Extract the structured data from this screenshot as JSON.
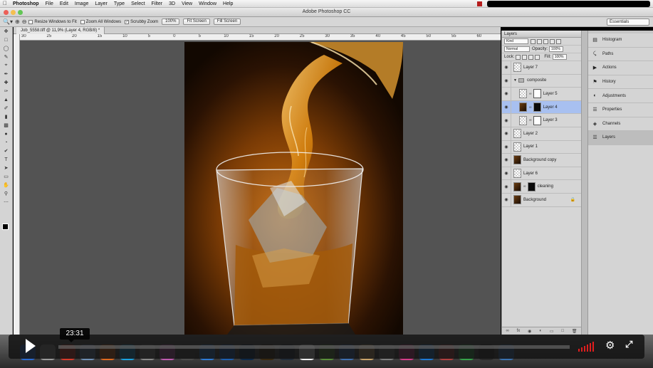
{
  "menubar": {
    "app_name": "Photoshop",
    "items": [
      "File",
      "Edit",
      "Image",
      "Layer",
      "Type",
      "Select",
      "Filter",
      "3D",
      "View",
      "Window",
      "Help"
    ]
  },
  "window": {
    "title": "Adobe Photoshop CC"
  },
  "options_bar": {
    "checkboxes": [
      {
        "label": "Resize Windows to Fit",
        "checked": false
      },
      {
        "label": "Zoom All Windows",
        "checked": false
      },
      {
        "label": "Scrubby Zoom",
        "checked": true
      }
    ],
    "buttons": [
      "100%",
      "Fit Screen",
      "Fill Screen"
    ],
    "workspace": "Essentials"
  },
  "document": {
    "tab_title": "Job_5558.tiff @ 11,9% (Layer 4, RGB/8) *",
    "ruler_ticks": [
      "30",
      "25",
      "20",
      "15",
      "10",
      "5",
      "0",
      "5",
      "10",
      "15",
      "20",
      "25",
      "30",
      "35",
      "40",
      "45",
      "50",
      "55",
      "60"
    ]
  },
  "layers_panel": {
    "tab_label": "Layers",
    "kind_filter": "Kind",
    "blend_mode": "Normal",
    "opacity_label": "Opacity:",
    "opacity_value": "100%",
    "lock_label": "Lock:",
    "fill_label": "Fill:",
    "fill_value": "100%",
    "layers": [
      {
        "name": "Layer 7",
        "thumb": "transparent",
        "selected": false,
        "indent": false
      },
      {
        "name": "composite",
        "thumb": "group",
        "selected": false,
        "indent": false
      },
      {
        "name": "Layer 5",
        "thumb": "transparent",
        "mask": true,
        "selected": false,
        "indent": true
      },
      {
        "name": "Layer 4",
        "thumb": "photo",
        "mask": true,
        "selected": true,
        "indent": true
      },
      {
        "name": "Layer 3",
        "thumb": "transparent",
        "mask": true,
        "selected": false,
        "indent": true
      },
      {
        "name": "Layer 2",
        "thumb": "transparent",
        "selected": false,
        "indent": false
      },
      {
        "name": "Layer 1",
        "thumb": "transparent",
        "selected": false,
        "indent": false
      },
      {
        "name": "Background copy",
        "thumb": "photo",
        "selected": false,
        "indent": false
      },
      {
        "name": "Layer 6",
        "thumb": "transparent",
        "selected": false,
        "indent": false
      },
      {
        "name": "cleaning",
        "thumb": "photo",
        "mask": true,
        "selected": false,
        "indent": false
      },
      {
        "name": "Background",
        "thumb": "photo",
        "locked": true,
        "selected": false,
        "indent": false
      }
    ]
  },
  "dock_panels": [
    {
      "label": "Histogram",
      "icon": "histogram-icon",
      "active": false
    },
    {
      "label": "Paths",
      "icon": "paths-icon",
      "active": false
    },
    {
      "label": "Actions",
      "icon": "actions-icon",
      "active": false
    },
    {
      "label": "History",
      "icon": "history-icon",
      "active": false
    },
    {
      "label": "Adjustments",
      "icon": "adjustments-icon",
      "active": false
    },
    {
      "label": "Properties",
      "icon": "properties-icon",
      "active": false
    },
    {
      "label": "Channels",
      "icon": "channels-icon",
      "active": false
    },
    {
      "label": "Layers",
      "icon": "layers-icon",
      "active": true
    }
  ],
  "video_player": {
    "time_label": "23:31",
    "colors": {
      "bars": "#e01e1e",
      "overlay": "#141414"
    }
  },
  "colors": {
    "canvas_bg": "#535353",
    "panel_bg": "#d6d6d6",
    "selected_layer": "#a8c0f0"
  }
}
